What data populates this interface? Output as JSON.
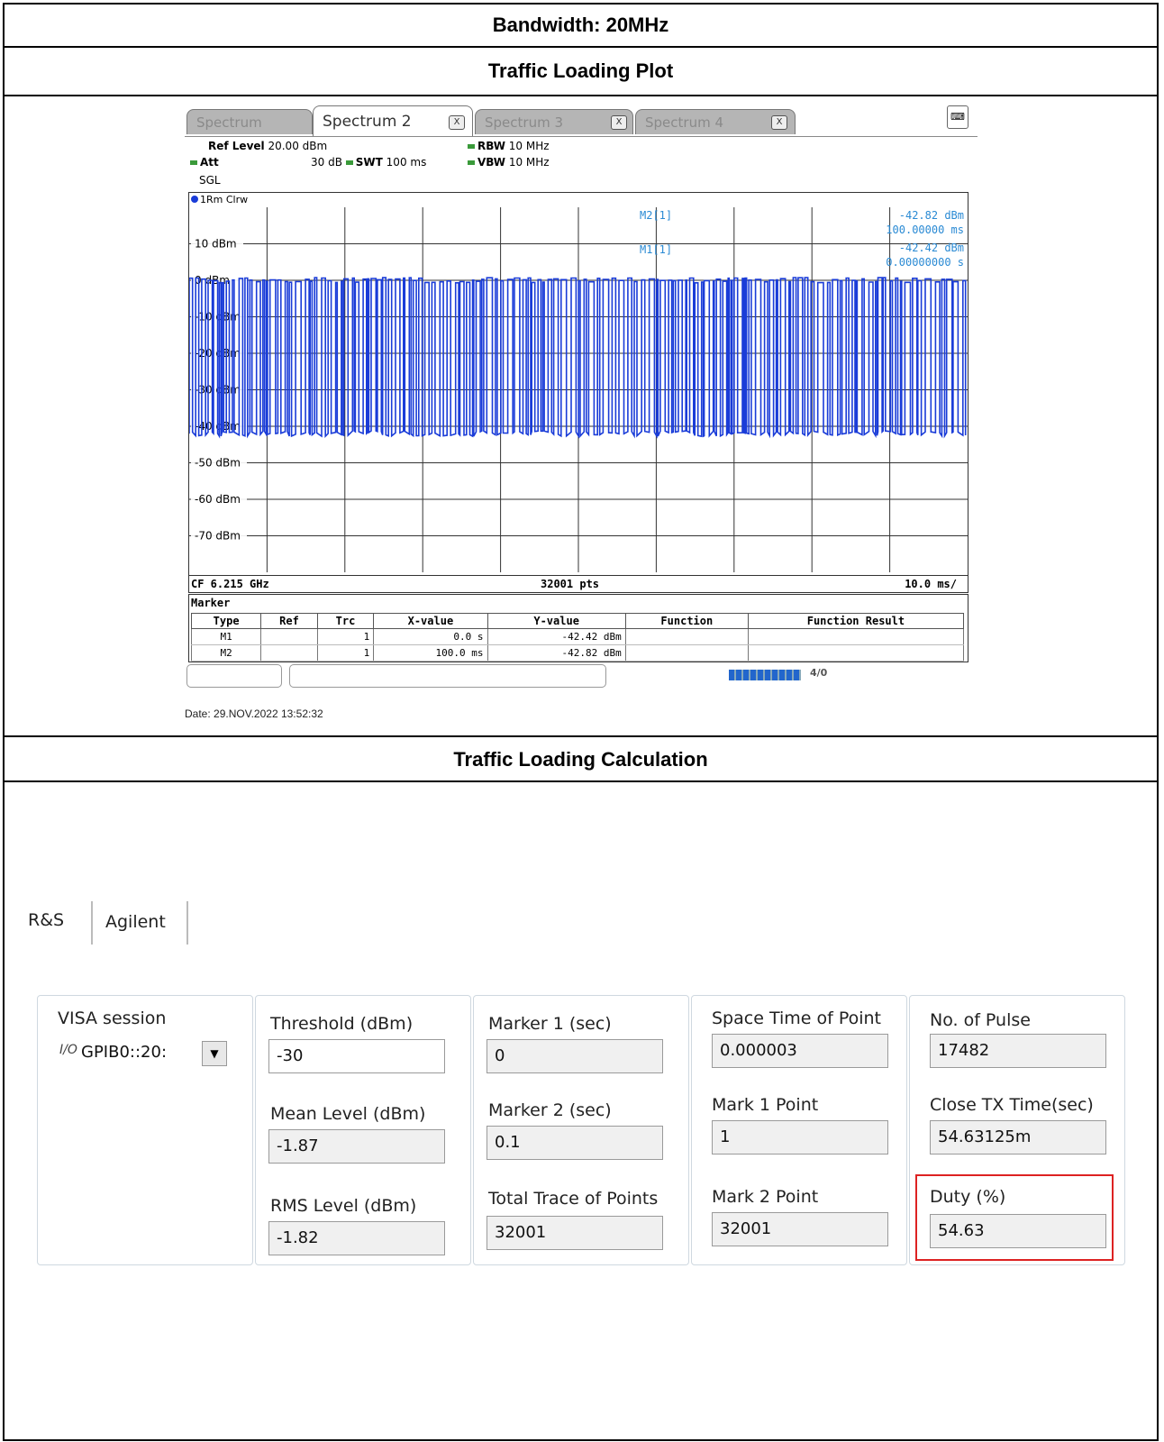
{
  "header": {
    "bandwidth": "Bandwidth: 20MHz",
    "plot_title": "Traffic Loading Plot",
    "calc_title": "Traffic Loading Calculation"
  },
  "analyzer": {
    "tabs": [
      {
        "label": "Spectrum",
        "active": false
      },
      {
        "label": "Spectrum 2",
        "active": true
      },
      {
        "label": "Spectrum 3",
        "active": false
      },
      {
        "label": "Spectrum 4",
        "active": false
      }
    ],
    "ref_level_label": "Ref Level",
    "ref_level_value": "20.00 dBm",
    "att_label": "Att",
    "att_value": "30 dB",
    "swt_label": "SWT",
    "swt_value": "100 ms",
    "rbw_label": "RBW",
    "rbw_value": "10 MHz",
    "vbw_label": "VBW",
    "vbw_value": "10 MHz",
    "sgl": "SGL",
    "trace_label": "1Rm Clrw",
    "markers_readout": {
      "m2_name": "M2[1]",
      "m2_level": "-42.82 dBm",
      "m2_time": "100.00000 ms",
      "m1_name": "M1[1]",
      "m1_level": "-42.42 dBm",
      "m1_time": "0.00000000 s"
    },
    "cf": "CF 6.215 GHz",
    "pts": "32001 pts",
    "per_div": "10.0 ms/",
    "marker_title": "Marker",
    "marker_table": {
      "headers": [
        "Type",
        "Ref",
        "Trc",
        "X-value",
        "Y-value",
        "Function",
        "Function Result"
      ],
      "rows": [
        [
          "M1",
          "",
          "1",
          "0.0 s",
          "-42.42 dBm",
          "",
          ""
        ],
        [
          "M2",
          "",
          "1",
          "100.0 ms",
          "-42.82 dBm",
          "",
          ""
        ]
      ]
    },
    "date": "Date: 29.NOV.2022  13:52:32",
    "status_text": "4/0",
    "trace_color": "#1a3cd8"
  },
  "chart_data": {
    "type": "line",
    "xlabel": "",
    "ylabel": "",
    "x_range_ms": [
      0,
      100
    ],
    "ylim": [
      -80,
      20
    ],
    "y_tick_labels": [
      "10 dBm",
      "0 dBm",
      "-10 dBm",
      "-20 dBm",
      "-30 dBm",
      "-40 dBm",
      "-50 dBm",
      "-60 dBm",
      "-70 dBm"
    ],
    "signal_high_dbm": 0,
    "signal_low_dbm": -42,
    "duty_percent": 54.63,
    "grid": true
  },
  "calc": {
    "tabs": [
      "R&S",
      "Agilent"
    ],
    "visa_label": "VISA session",
    "visa_value": "GPIB0::20:",
    "visa_icon": "I/O",
    "threshold_label": "Threshold (dBm)",
    "threshold_value": "-30",
    "mean_label": "Mean Level (dBm)",
    "mean_value": "-1.87",
    "rms_label": "RMS Level (dBm)",
    "rms_value": "-1.82",
    "marker1_label": "Marker 1 (sec)",
    "marker1_value": "0",
    "marker2_label": "Marker 2 (sec)",
    "marker2_value": "0.1",
    "total_label": "Total Trace of Points",
    "total_value": "32001",
    "space_label": "Space Time of Point",
    "space_value": "0.000003",
    "mark1_point_label": "Mark 1 Point",
    "mark1_point_value": "1",
    "mark2_point_label": "Mark 2 Point",
    "mark2_point_value": "32001",
    "pulse_label": "No. of Pulse",
    "pulse_value": "17482",
    "close_label": "Close TX Time(sec)",
    "close_value": "54.63125m",
    "duty_label": "Duty (%)",
    "duty_value": "54.63",
    "highlight_color": "#dd2222"
  }
}
